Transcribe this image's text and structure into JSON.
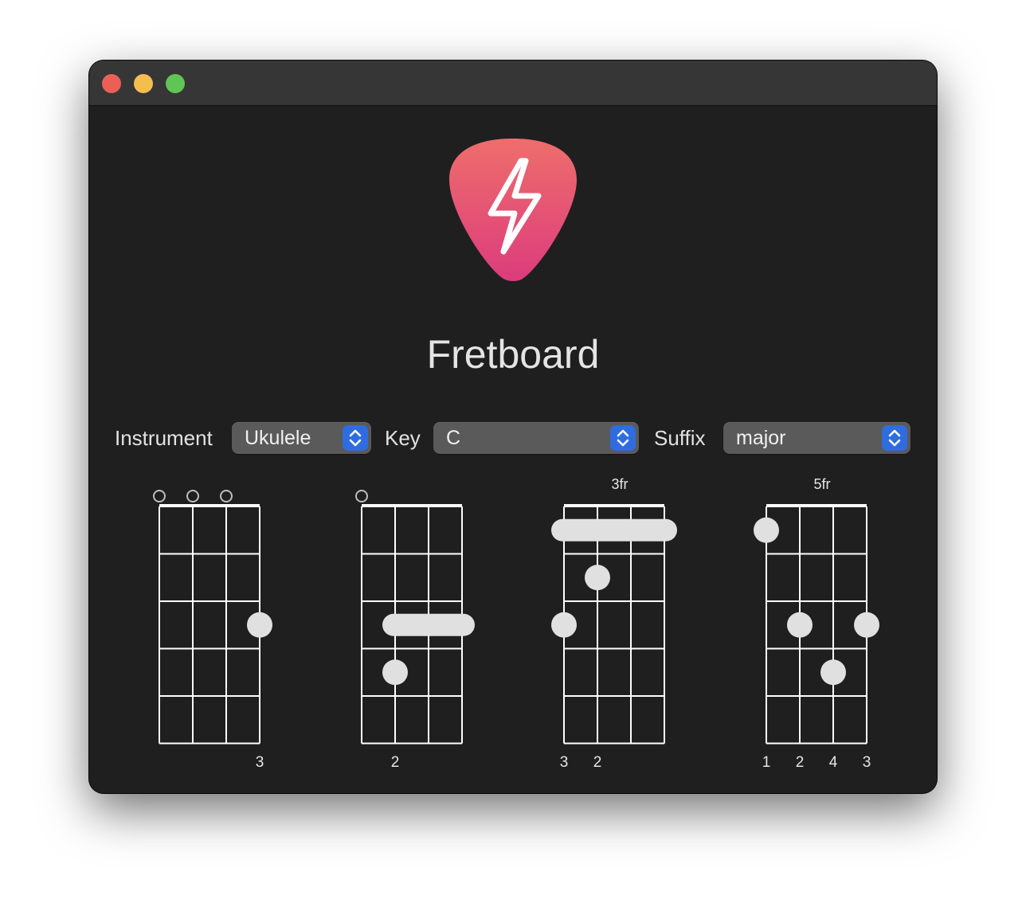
{
  "window": {
    "traffic_lights": [
      "close",
      "minimize",
      "zoom"
    ],
    "app_icon": "guitar-pick-lightning-icon",
    "app_title": "Fretboard"
  },
  "colors": {
    "accent": "#2f6ce0",
    "icon_gradient_top": "#ee6e6c",
    "icon_gradient_bottom": "#dc3c7c",
    "background": "#1f1f1f",
    "diagram_line": "#ffffff",
    "finger_dot": "#e0e0e0"
  },
  "controls": {
    "instrument": {
      "label": "Instrument",
      "value": "Ukulele"
    },
    "key": {
      "label": "Key",
      "value": "C"
    },
    "suffix": {
      "label": "Suffix",
      "value": "major"
    }
  },
  "chords": [
    {
      "base_fret_label": "",
      "open_strings": [
        0,
        1,
        2
      ],
      "barres": [],
      "dots": [
        {
          "string": 3,
          "fret": 3
        }
      ],
      "fingers": [
        "",
        "",
        "",
        "3"
      ]
    },
    {
      "base_fret_label": "",
      "open_strings": [
        0
      ],
      "barres": [
        {
          "fret": 3,
          "from": 1,
          "to": 3
        }
      ],
      "dots": [
        {
          "string": 1,
          "fret": 4
        }
      ],
      "fingers": [
        "",
        "2",
        "",
        ""
      ]
    },
    {
      "base_fret_label": "3fr",
      "open_strings": [],
      "barres": [
        {
          "fret": 1,
          "from": 0,
          "to": 3
        }
      ],
      "dots": [
        {
          "string": 1,
          "fret": 2
        },
        {
          "string": 0,
          "fret": 3
        }
      ],
      "fingers": [
        "3",
        "2",
        "",
        ""
      ]
    },
    {
      "base_fret_label": "5fr",
      "open_strings": [],
      "barres": [],
      "dots": [
        {
          "string": 0,
          "fret": 1
        },
        {
          "string": 1,
          "fret": 3
        },
        {
          "string": 3,
          "fret": 3
        },
        {
          "string": 2,
          "fret": 4
        }
      ],
      "fingers": [
        "1",
        "2",
        "4",
        "3"
      ]
    }
  ]
}
